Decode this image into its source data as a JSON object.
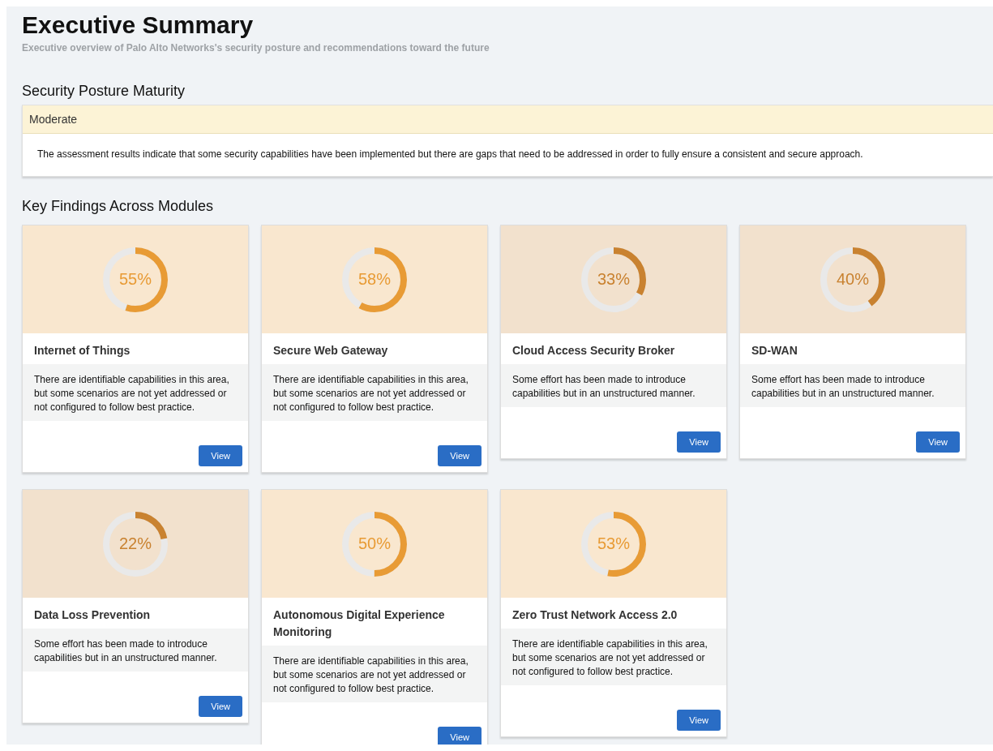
{
  "header": {
    "title": "Executive Summary",
    "subtitle": "Executive overview of Palo Alto Networks's security posture and recommendations toward the future"
  },
  "posture": {
    "heading": "Security Posture Maturity",
    "rating": "Moderate",
    "description": "The assessment results indicate that some security capabilities have been implemented but there are gaps that need to be addressed in order to fully ensure a consistent and secure approach."
  },
  "findings": {
    "heading": "Key Findings Across Modules",
    "modules": [
      {
        "name": "Internet of Things",
        "percent": "55%",
        "level": 0.55,
        "color": "#e89b35",
        "description": "There are identifiable capabilities in this area, but some scenarios are not yet addressed or not configured to follow best practice.",
        "button": "View"
      },
      {
        "name": "Secure Web Gateway",
        "percent": "58%",
        "level": 0.58,
        "color": "#e89b35",
        "description": "There are identifiable capabilities in this area, but some scenarios are not yet addressed or not configured to follow best practice.",
        "button": "View"
      },
      {
        "name": "Cloud Access Security Broker",
        "percent": "33%",
        "level": 0.33,
        "color": "#c98230",
        "description": "Some effort has been made to introduce capabilities but in an unstructured manner.",
        "button": "View"
      },
      {
        "name": "SD-WAN",
        "percent": "40%",
        "level": 0.4,
        "color": "#c98230",
        "description": "Some effort has been made to introduce capabilities but in an unstructured manner.",
        "button": "View"
      },
      {
        "name": "Data Loss Prevention",
        "percent": "22%",
        "level": 0.22,
        "color": "#c98230",
        "description": "Some effort has been made to introduce capabilities but in an unstructured manner.",
        "button": "View"
      },
      {
        "name": "Autonomous Digital Experience Monitoring",
        "percent": "50%",
        "level": 0.5,
        "color": "#e89b35",
        "description": "There are identifiable capabilities in this area, but some scenarios are not yet addressed or not configured to follow best practice.",
        "button": "View"
      },
      {
        "name": "Zero Trust Network Access 2.0",
        "percent": "53%",
        "level": 0.53,
        "color": "#e89b35",
        "description": "There are identifiable capabilities in this area, but some scenarios are not yet addressed or not configured to follow best practice.",
        "button": "View"
      }
    ]
  }
}
